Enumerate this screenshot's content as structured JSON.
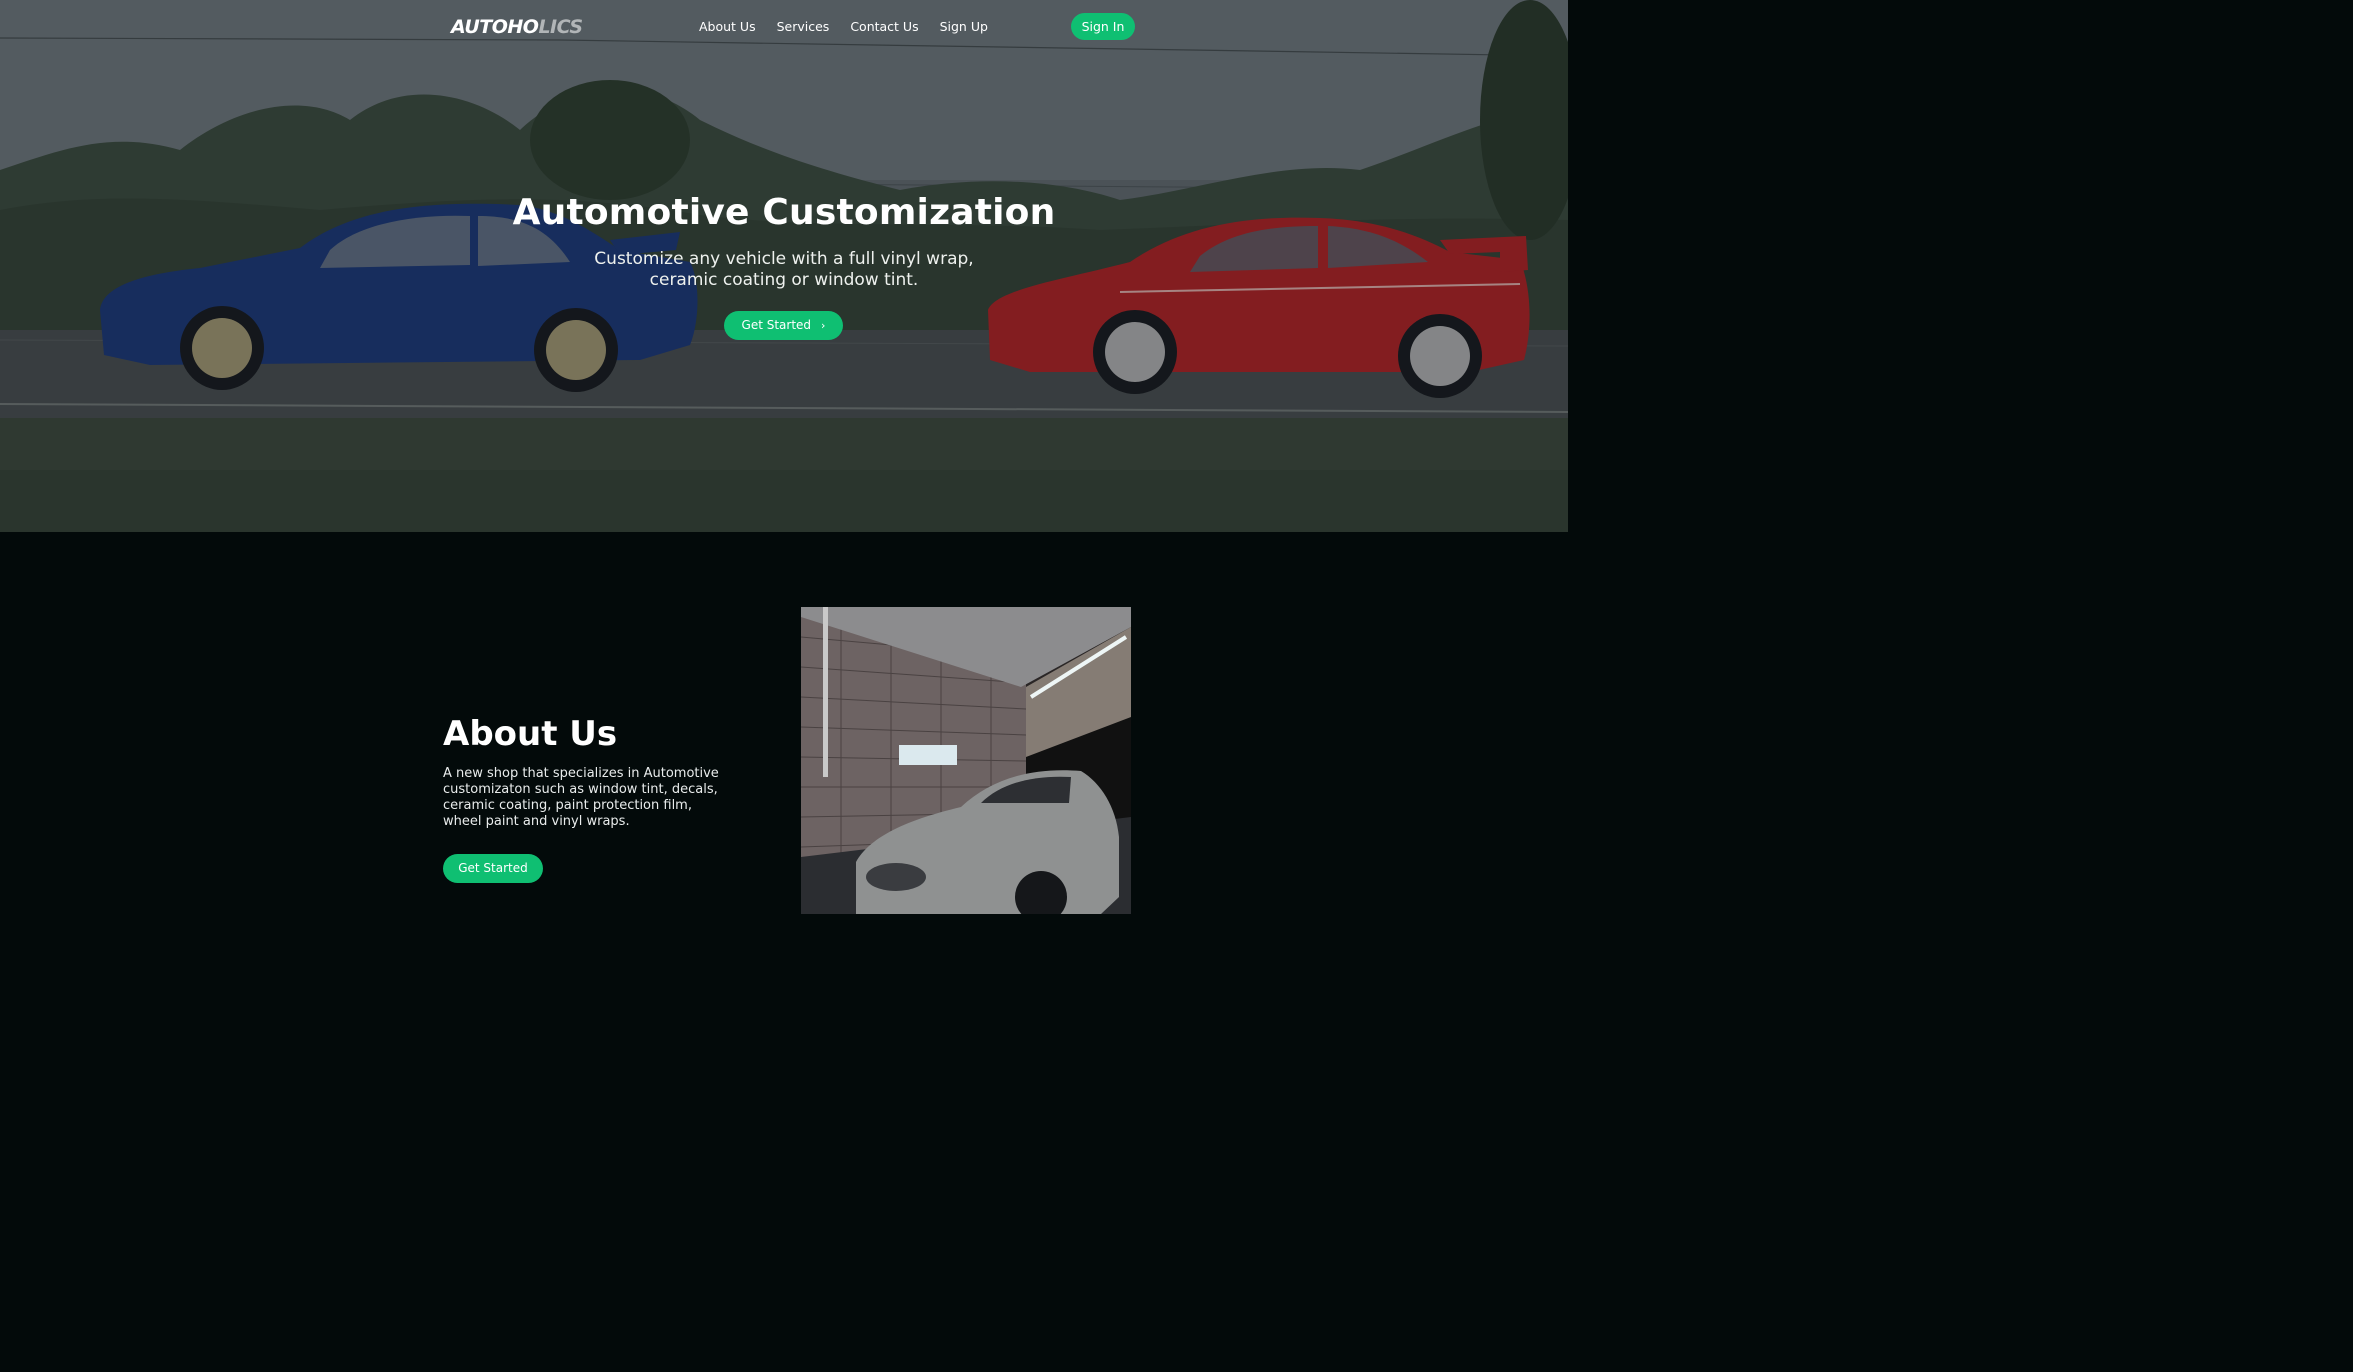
{
  "nav": {
    "logo_main": "AUTOHO",
    "logo_tail": "LICS",
    "links": [
      "About Us",
      "Services",
      "Contact Us",
      "Sign Up"
    ],
    "signin_label": "Sign In"
  },
  "hero": {
    "title": "Automotive Customization",
    "subtitle": "Customize any vehicle with a full vinyl wrap, ceramic coating or window tint.",
    "cta_label": "Get Started",
    "cta_icon": "chevron-right-icon"
  },
  "about": {
    "title": "About Us",
    "text": "A new shop that specializes in Automotive customizaton such as window tint, decals, ceramic coating, paint protection film, wheel paint and vinyl wraps.",
    "cta_label": "Get Started"
  },
  "colors": {
    "accent": "#0fbf72",
    "background": "#030a0a"
  }
}
